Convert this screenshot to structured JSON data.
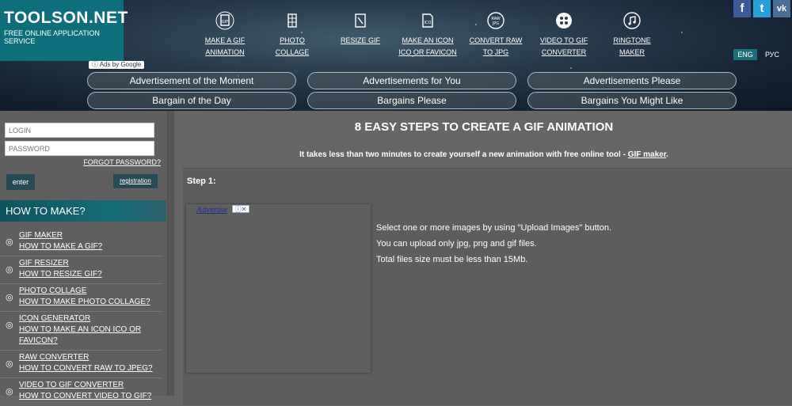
{
  "header": {
    "logo_name": "TOOLSON.NET",
    "logo_tag": "FREE ONLINE APPLICATION SERVICE",
    "nav": [
      {
        "icon": "gif-file-icon",
        "label": "MAKE A GIF ANIMATION"
      },
      {
        "icon": "photo-collage-icon",
        "label": "PHOTO COLLAGE"
      },
      {
        "icon": "resize-icon",
        "label": "RESIZE GIF"
      },
      {
        "icon": "ico-file-icon",
        "label": "MAKE AN ICON ICO OR FAVICON"
      },
      {
        "icon": "raw-convert-icon",
        "label": "CONVERT RAW TO JPG"
      },
      {
        "icon": "film-reel-icon",
        "label": "VIDEO TO GIF CONVERTER"
      },
      {
        "icon": "music-note-icon",
        "label": "RINGTONE MAKER"
      }
    ],
    "social": [
      {
        "icon": "facebook-icon",
        "glyph": "f",
        "color": "#3b5a9a"
      },
      {
        "icon": "twitter-icon",
        "glyph": "t",
        "color": "#27a0d8"
      },
      {
        "icon": "vk-icon",
        "glyph": "vk",
        "color": "#4a6f96"
      }
    ],
    "languages": [
      "ENG",
      "РУС"
    ],
    "ads_by": "Ads by Google",
    "ad_links": [
      "Advertisement of the Moment",
      "Advertisements for You",
      "Advertisements Please",
      "Bargain of the Day",
      "Bargains Please",
      "Bargains You Might Like"
    ]
  },
  "sidebar": {
    "login_placeholder": "LOGIN",
    "password_placeholder": "PASSWORD",
    "forgot": "FORGOT PASSWORD?",
    "enter": "enter",
    "registration": "registration",
    "howto_title": "HOW TO MAKE?",
    "items": [
      {
        "title": "GIF MAKER",
        "sub": "HOW TO MAKE A GIF?"
      },
      {
        "title": "GIF RESIZER",
        "sub": "HOW TO RESIZE GIF?"
      },
      {
        "title": "PHOTO COLLAGE",
        "sub": "HOW TO MAKE PHOTO COLLAGE?"
      },
      {
        "title": "ICON GENERATOR",
        "sub": "HOW TO MAKE AN ICON ICO OR FAVICON?"
      },
      {
        "title": "RAW CONVERTER",
        "sub": "HOW TO CONVERT RAW TO JPEG?"
      },
      {
        "title": "VIDEO TO GIF CONVERTER",
        "sub": "HOW TO CONVERT VIDEO TO GIF?"
      }
    ]
  },
  "main": {
    "title": "8 EASY STEPS TO CREATE A GIF ANIMATION",
    "subtitle_pre": "It takes less than two minutes to create yourself a new animation with free online tool - ",
    "subtitle_link": "GIF maker",
    "subtitle_post": ".",
    "step_label": "Step 1:",
    "ad_text": "Advertise",
    "ad_controls": "ⓘ✕",
    "instructions": [
      "Select one or more images by using \"Upload Images\" button.",
      "You can upload only jpg, png and gif files.",
      "Total files size must be less than 15Mb."
    ]
  }
}
